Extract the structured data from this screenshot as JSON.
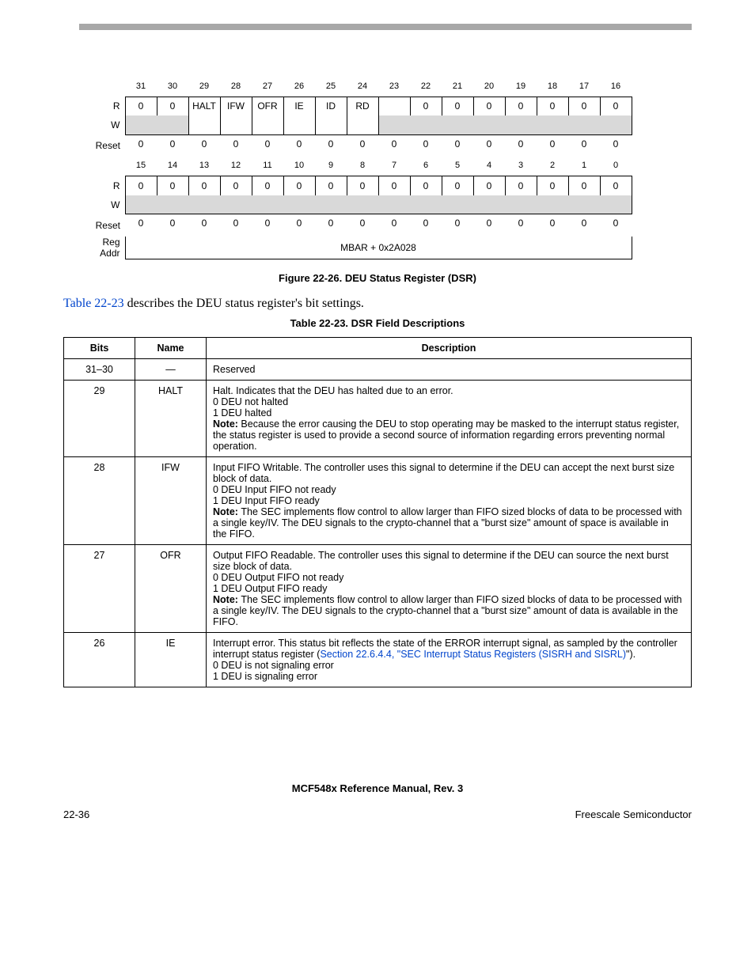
{
  "register": {
    "bits_high": [
      "31",
      "30",
      "29",
      "28",
      "27",
      "26",
      "25",
      "24",
      "23",
      "22",
      "21",
      "20",
      "19",
      "18",
      "17",
      "16"
    ],
    "r_high": [
      "0",
      "0",
      "HALT",
      "IFW",
      "OFR",
      "IE",
      "ID",
      "RD",
      "",
      "0",
      "0",
      "0",
      "0",
      "0",
      "0",
      "0"
    ],
    "reset_high": [
      "0",
      "0",
      "0",
      "0",
      "0",
      "0",
      "0",
      "0",
      "0",
      "0",
      "0",
      "0",
      "0",
      "0",
      "0",
      "0"
    ],
    "bits_low": [
      "15",
      "14",
      "13",
      "12",
      "11",
      "10",
      "9",
      "8",
      "7",
      "6",
      "5",
      "4",
      "3",
      "2",
      "1",
      "0"
    ],
    "r_low": [
      "0",
      "0",
      "0",
      "0",
      "0",
      "0",
      "0",
      "0",
      "0",
      "0",
      "0",
      "0",
      "0",
      "0",
      "0",
      "0"
    ],
    "reset_low": [
      "0",
      "0",
      "0",
      "0",
      "0",
      "0",
      "0",
      "0",
      "0",
      "0",
      "0",
      "0",
      "0",
      "0",
      "0",
      "0"
    ],
    "labels": {
      "r": "R",
      "w": "W",
      "reset": "Reset",
      "reg_addr": "Reg\nAddr"
    },
    "addr": "MBAR + 0x2A028"
  },
  "figure_caption": "Figure 22-26. DEU Status Register (DSR)",
  "intro": {
    "link": "Table 22-23",
    "rest": " describes the DEU status register's bit settings."
  },
  "table_caption": "Table 22-23. DSR Field Descriptions",
  "table": {
    "headers": {
      "bits": "Bits",
      "name": "Name",
      "desc": "Description"
    },
    "rows": [
      {
        "bits": "31–30",
        "name": "—",
        "desc": [
          {
            "t": "text",
            "v": "Reserved"
          }
        ]
      },
      {
        "bits": "29",
        "name": "HALT",
        "desc": [
          {
            "t": "text",
            "v": "Halt. Indicates that the DEU has halted due to an error."
          },
          {
            "t": "text",
            "v": "0 DEU not halted"
          },
          {
            "t": "text",
            "v": "1 DEU halted"
          },
          {
            "t": "note",
            "b": "Note:  ",
            "v": "Because the error causing the DEU to stop operating may be masked to the interrupt status register, the status register is used to provide a second source of information regarding errors preventing normal operation."
          }
        ]
      },
      {
        "bits": "28",
        "name": "IFW",
        "desc": [
          {
            "t": "text",
            "v": "Input FIFO Writable. The controller uses this signal to determine if the DEU can accept the next burst size block of data."
          },
          {
            "t": "text",
            "v": "0 DEU Input FIFO not ready"
          },
          {
            "t": "text",
            "v": "1 DEU Input FIFO ready"
          },
          {
            "t": "note",
            "b": "Note:  ",
            "v": "The SEC implements flow control to allow larger than FIFO sized blocks of data to be processed with a single key/IV. The DEU signals to the crypto-channel that a \"burst size\" amount of space is available in the FIFO."
          }
        ]
      },
      {
        "bits": "27",
        "name": "OFR",
        "desc": [
          {
            "t": "text",
            "v": "Output FIFO Readable. The controller uses this signal to determine if the DEU can source the next burst size block of data."
          },
          {
            "t": "text",
            "v": "0 DEU Output FIFO not ready"
          },
          {
            "t": "text",
            "v": "1 DEU Output FIFO ready"
          },
          {
            "t": "note",
            "b": "Note:  ",
            "v": "The SEC implements flow control to allow larger than FIFO sized blocks of data to be processed with a single key/IV. The DEU signals to the crypto-channel that a \"burst size\" amount of data is available in the FIFO."
          }
        ]
      },
      {
        "bits": "26",
        "name": "IE",
        "desc": [
          {
            "t": "mix",
            "pre": "Interrupt error. This status bit reflects the state of the ERROR interrupt signal, as sampled by the controller interrupt status register (",
            "link": "Section 22.6.4.4, \"SEC Interrupt Status Registers (SISRH and SISRL)",
            "post": "\")."
          },
          {
            "t": "text",
            "v": "0 DEU is not signaling error"
          },
          {
            "t": "text",
            "v": "1 DEU is signaling error"
          }
        ]
      }
    ]
  },
  "footer": {
    "title": "MCF548x Reference Manual, Rev. 3",
    "left": "22-36",
    "right": "Freescale Semiconductor"
  }
}
